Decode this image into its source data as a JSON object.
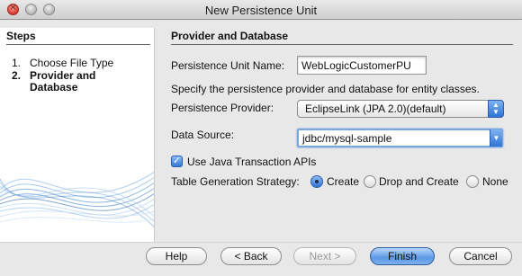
{
  "window": {
    "title": "New Persistence Unit"
  },
  "steps": {
    "heading": "Steps",
    "items": [
      {
        "num": "1.",
        "label": "Choose File Type",
        "active": false
      },
      {
        "num": "2.",
        "label": "Provider and Database",
        "active": true
      }
    ]
  },
  "panel": {
    "heading": "Provider and Database",
    "unit_name_label": "Persistence Unit Name:",
    "unit_name_value": "WebLogicCustomerPU",
    "description": "Specify the persistence provider and database for entity classes.",
    "provider_label": "Persistence Provider:",
    "provider_value": "EclipseLink (JPA 2.0)(default)",
    "datasource_label": "Data Source:",
    "datasource_value": "jdbc/mysql-sample",
    "jta_label": "Use Java Transaction APIs",
    "jta_checked": true,
    "strategy_label": "Table Generation Strategy:",
    "strategy_options": [
      "Create",
      "Drop and Create",
      "None"
    ],
    "strategy_selected": "Create"
  },
  "buttons": {
    "help": "Help",
    "back": "< Back",
    "next": "Next >",
    "finish": "Finish",
    "cancel": "Cancel"
  }
}
